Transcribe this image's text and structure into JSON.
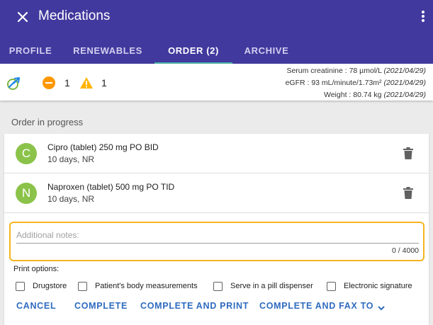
{
  "header": {
    "title": "Medications",
    "close_icon": "close-icon",
    "menu_icon": "more-vert-icon",
    "background": "#42399e",
    "tabs": [
      {
        "label": "PROFILE",
        "active": false
      },
      {
        "label": "RENEWABLES",
        "active": false
      },
      {
        "label": "ORDER (2)",
        "active": true
      },
      {
        "label": "ARCHIVE",
        "active": false
      }
    ],
    "active_indicator_color": "#4db6ac"
  },
  "info_bar": {
    "status_icon": "pill-arrow-icon",
    "minus_count": "1",
    "warning_count": "1",
    "labs": [
      {
        "label": "Serum creatinine : 78 µmol/L",
        "date": "(2021/04/29)"
      },
      {
        "label": "eGFR : 93 mL/minute/1.73m²",
        "date": "(2021/04/29)"
      },
      {
        "label": "Weight : 80.74 kg",
        "date": "(2021/04/29)"
      }
    ]
  },
  "order": {
    "title": "Order in progress",
    "medications": [
      {
        "initial": "C",
        "name": "Cipro (tablet) 250 mg PO BID",
        "detail": "10 days, NR"
      },
      {
        "initial": "N",
        "name": "Naproxen (tablet) 500 mg PO TID",
        "detail": "10 days, NR"
      }
    ],
    "notes": {
      "placeholder": "Additional notes:",
      "value": "",
      "counter": "0 / 4000",
      "highlight_color": "#f5b520"
    },
    "print_options_label": "Print options:",
    "print_options": [
      {
        "label": "Drugstore",
        "checked": false
      },
      {
        "label": "Patient's body measurements",
        "checked": false
      },
      {
        "label": "Serve in a pill dispenser",
        "checked": false
      },
      {
        "label": "Electronic signature",
        "checked": false
      }
    ],
    "actions": {
      "cancel": "CANCEL",
      "complete": "COMPLETE",
      "complete_print": "COMPLETE AND PRINT",
      "complete_fax": "COMPLETE AND FAX TO"
    },
    "accent_color": "#2f6bbf"
  }
}
